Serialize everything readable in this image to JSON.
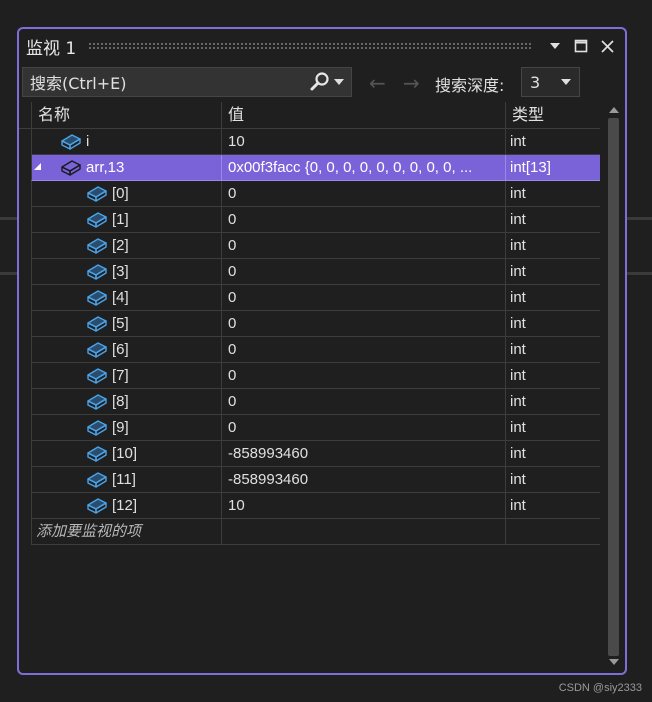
{
  "window": {
    "title": "监视 1"
  },
  "toolbar": {
    "search_placeholder": "搜索(Ctrl+E)",
    "back_arrow": "←",
    "forward_arrow": "→",
    "depth_label": "搜索深度:",
    "depth_value": "3"
  },
  "columns": {
    "name": "名称",
    "value": "值",
    "type": "类型"
  },
  "rows": [
    {
      "name": "i",
      "value": "10",
      "type": "int"
    },
    {
      "name": "arr,13",
      "value": "0x00f3facc {0, 0, 0, 0, 0, 0, 0, 0, 0, ...",
      "type": "int[13]"
    },
    {
      "name": "[0]",
      "value": "0",
      "type": "int"
    },
    {
      "name": "[1]",
      "value": "0",
      "type": "int"
    },
    {
      "name": "[2]",
      "value": "0",
      "type": "int"
    },
    {
      "name": "[3]",
      "value": "0",
      "type": "int"
    },
    {
      "name": "[4]",
      "value": "0",
      "type": "int"
    },
    {
      "name": "[5]",
      "value": "0",
      "type": "int"
    },
    {
      "name": "[6]",
      "value": "0",
      "type": "int"
    },
    {
      "name": "[7]",
      "value": "0",
      "type": "int"
    },
    {
      "name": "[8]",
      "value": "0",
      "type": "int"
    },
    {
      "name": "[9]",
      "value": "0",
      "type": "int"
    },
    {
      "name": "[10]",
      "value": "-858993460",
      "type": "int"
    },
    {
      "name": "[11]",
      "value": "-858993460",
      "type": "int"
    },
    {
      "name": "[12]",
      "value": "10",
      "type": "int"
    }
  ],
  "add_item_placeholder": "添加要监视的项",
  "watermark": "CSDN @siy2333",
  "colors": {
    "accent": "#7e6ed8",
    "selection": "#7a63d9",
    "icon": "#4aa3e8"
  }
}
